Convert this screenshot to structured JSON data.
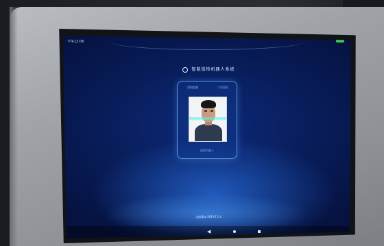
{
  "status_bar": {
    "time": "下午12:06",
    "battery_color": "#36d05a"
  },
  "app": {
    "title": "智能巡检机器人系统"
  },
  "panel": {
    "tabs": [
      "识别信息",
      "人脸搜索"
    ],
    "label": "巡检机器人"
  },
  "footer": {
    "version": "当前版本 RBPYS 5.4"
  },
  "nav": {
    "back": "◀",
    "home": "home-icon",
    "recent": "recent-apps-icon"
  },
  "colors": {
    "accent": "#5aa8ff",
    "screen_bg": "#081c58"
  }
}
